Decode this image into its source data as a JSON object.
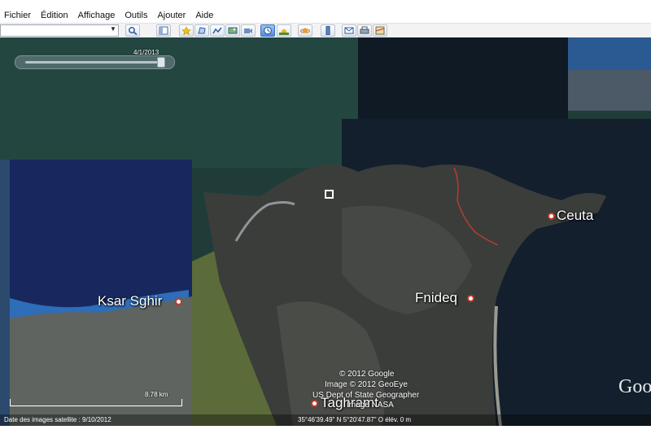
{
  "menu": [
    "Fichier",
    "Édition",
    "Affichage",
    "Outils",
    "Ajouter",
    "Aide"
  ],
  "toolbar": {
    "search_value": "",
    "buttons": [
      "search-icon",
      "sidebar-icon",
      "placemark-icon",
      "polygon-icon",
      "path-icon",
      "overlay-icon",
      "tour-icon",
      "history-icon",
      "sunlight-icon",
      "planets-icon",
      "ruler-icon",
      "email-icon",
      "print-icon",
      "maps-icon"
    ]
  },
  "map": {
    "time_slider": {
      "date": "4/1/2013",
      "position": 0.95
    },
    "places": {
      "ceuta": "Ceuta",
      "fnideq": "Fnideq",
      "ksar": "Ksar Sghir",
      "taghramt": "Taghramt"
    },
    "credits": {
      "line1": "© 2012 Google",
      "line2": "Image © 2012 GeoEye",
      "line3": "US Dept of State Geographer",
      "line4": "Image NASA"
    },
    "scale_label": "8.78 km",
    "google_logo": "Goo"
  },
  "status": {
    "imagery_date": "Date des images satellite : 9/10/2012",
    "coords": "35°46'39.49\" N   5°20'47.87\" O  élév.    0 m"
  },
  "colors": {
    "sea": "#1e3b38",
    "deep_sea": "#13204f",
    "coast": "#2d5fb3",
    "route": "#c0392b"
  }
}
